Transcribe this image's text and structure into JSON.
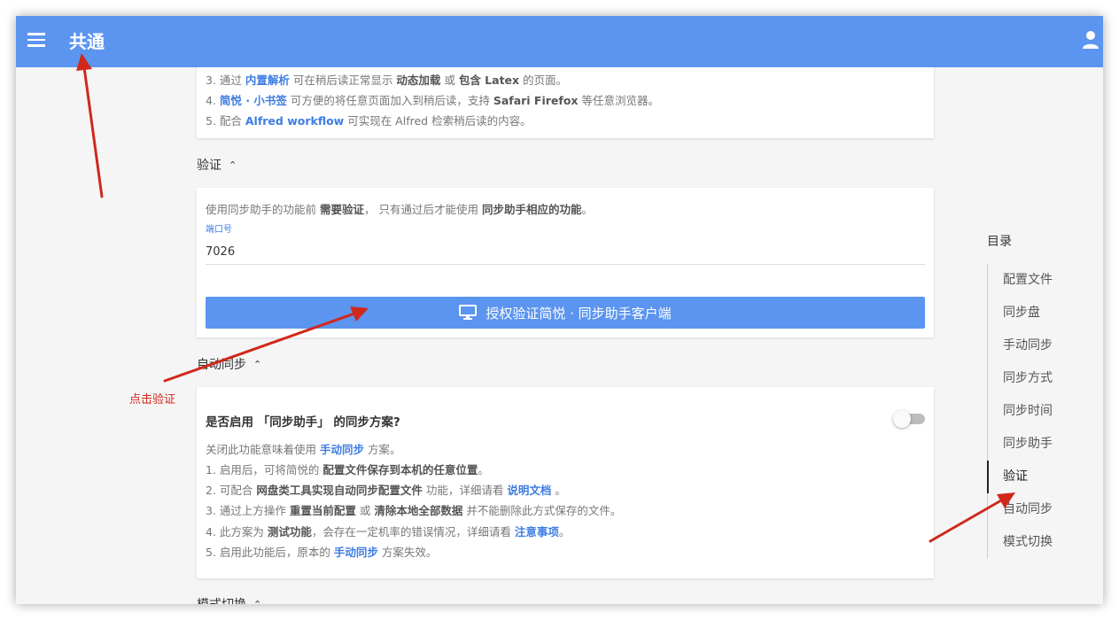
{
  "appbar": {
    "title": "共通",
    "menu_icon": "menu-icon",
    "user_icon": "account-icon",
    "color": "#5b95f0"
  },
  "intro_card": {
    "line3": {
      "prefix": "3. 通过 ",
      "link": "内置解析",
      "mid1": " 可在稍后读正常显示 ",
      "strong1": "动态加载",
      "mid2": " 或 ",
      "strong2": "包含 Latex",
      "suffix": " 的页面。"
    },
    "line4": {
      "prefix": "4. ",
      "link": "简悦 · 小书签",
      "mid": " 可方便的将任意页面加入到稍后读，支持 ",
      "strong": "Safari Firefox",
      "suffix": " 等任意浏览器。"
    },
    "line5": {
      "prefix": "5. 配合 ",
      "link": "Alfred workflow",
      "suffix": " 可实现在 Alfred 检索稍后读的内容。"
    }
  },
  "auth_section": {
    "heading": "验证",
    "desc": {
      "prefix": "使用同步助手的功能前 ",
      "strong1": "需要验证",
      "mid": "， 只有通过后才能使用 ",
      "strong2": "同步助手相应的功能",
      "suffix": "。"
    },
    "port_label": "端口号",
    "port_value": "7026",
    "button_label": "授权验证简悦 · 同步助手客户端",
    "button_icon": "monitor-icon"
  },
  "auto_sync_section": {
    "heading": "自动同步",
    "question": "是否启用 「同步助手」 的同步方案?",
    "toggle_on": false,
    "lines": {
      "l0": {
        "prefix": "关闭此功能意味着使用 ",
        "link": "手动同步",
        "suffix": " 方案。"
      },
      "l1": {
        "prefix": "1. 启用后，可将简悦的 ",
        "strong": "配置文件保存到本机的任意位置",
        "suffix": "。"
      },
      "l2": {
        "prefix": "2. 可配合 ",
        "strong": "网盘类工具实现自动同步配置文件",
        "mid": " 功能，详细请看 ",
        "link": "说明文档",
        "suffix": " 。"
      },
      "l3": {
        "prefix": "3. 通过上方操作 ",
        "strong1": "重置当前配置",
        "mid": " 或 ",
        "strong2": "清除本地全部数据",
        "suffix": " 并不能删除此方式保存的文件。"
      },
      "l4": {
        "prefix": "4. 此方案为 ",
        "strong": "测试功能",
        "mid": "，会存在一定机率的错误情况，详细请看 ",
        "link": "注意事项",
        "suffix": "。"
      },
      "l5": {
        "prefix": "5. 启用此功能后，原本的 ",
        "link": "手动同步",
        "suffix": " 方案失效。"
      }
    }
  },
  "next_section": {
    "heading": "模式切换"
  },
  "toc": {
    "title": "目录",
    "items": [
      "配置文件",
      "同步盘",
      "手动同步",
      "同步方式",
      "同步时间",
      "同步助手",
      "验证",
      "自动同步",
      "模式切换"
    ],
    "active_index": 6
  },
  "annotation": {
    "text": "点击验证",
    "color": "#d0281c"
  }
}
